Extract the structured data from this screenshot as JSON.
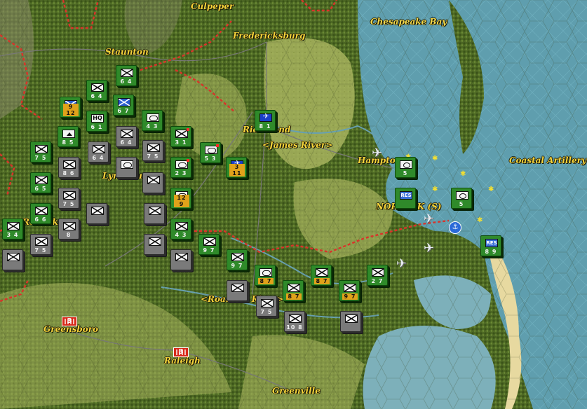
{
  "map": {
    "labels": {
      "culpeper": "Culpeper",
      "fredericksburg": "Fredericksburg",
      "chesapeake": "Chesapeake Bay",
      "staunton": "Staunton",
      "richmond": "Richmond",
      "james_river": "<James River>",
      "hampton": "Hampton",
      "coastal_artillery": "Coastal Artillery",
      "lynchburg": "Lynchburg",
      "norfolk": "NORFOLK (S)",
      "roanoke": "Roanoke",
      "roanoke_river": "<Roanoke River>",
      "greensboro": "Greensboro",
      "raleigh": "Raleigh",
      "greenville": "Greenville"
    },
    "city_markers": {
      "greensboro": "3",
      "raleigh": "3"
    },
    "colors": {
      "axis_unit": "#2f8a2a",
      "allied_unit": "#7a7a7a",
      "frontline": "#d8342a",
      "water": "#5a9aa8",
      "label": "#f6d43a"
    }
  },
  "units": {
    "u1": {
      "str": "6 4",
      "icon": "infantry-icon"
    },
    "u2": {
      "str": "6 4",
      "icon": "infantry-icon"
    },
    "u3": {
      "str": "9 12",
      "icon": "cavalry-icon"
    },
    "u4": {
      "str": "6 7",
      "icon": "cavalry-icon"
    },
    "u5": {
      "hq": "HQ",
      "str": "6 1",
      "icon": "hq-icon"
    },
    "u6": {
      "str": "8 5",
      "icon": "mountain-icon"
    },
    "u7": {
      "str": "4 3",
      "icon": "armor-icon"
    },
    "u8": {
      "str": "3 1",
      "icon": "infantry-icon"
    },
    "u9": {
      "str": "5 3",
      "icon": "armor-icon"
    },
    "u10": {
      "str": "2 3",
      "icon": "armor-icon"
    },
    "u11": {
      "str": "12 9",
      "icon": "armor-icon"
    },
    "u12": {
      "str": "4 3",
      "icon": "infantry-icon"
    },
    "u13": {
      "str": "8 1",
      "icon": "air-icon"
    },
    "u14": {
      "str": "3 11",
      "icon": "air-icon"
    },
    "u15": {
      "str": "7 5",
      "icon": "infantry-icon"
    },
    "u16": {
      "str": "6 5",
      "icon": "infantry-icon"
    },
    "u17": {
      "str": "9 7",
      "icon": "infantry-icon"
    },
    "u18": {
      "str": "8 7",
      "icon": "armor-icon"
    },
    "u19": {
      "str": "8 7",
      "icon": "infantry-icon"
    },
    "u20": {
      "str": "8 7",
      "icon": "infantry-icon"
    },
    "u21": {
      "str": "9 7",
      "icon": "infantry-icon"
    },
    "u22": {
      "str": "2 7",
      "icon": "infantry-icon"
    },
    "u23": {
      "str": "9 7",
      "icon": "infantry-icon"
    },
    "u24": {
      "str": "6 6",
      "icon": "infantry-icon"
    },
    "u25": {
      "str": "3 4",
      "icon": "infantry-icon"
    },
    "u26": {
      "str": "5",
      "icon": "coastal-icon"
    },
    "u27": {
      "res": "RES",
      "str": "",
      "icon": "reserve-icon"
    },
    "u28": {
      "str": "5",
      "icon": "coastal-icon"
    },
    "u29": {
      "res": "RES",
      "str": "8 9",
      "icon": "reserve-icon"
    },
    "g1": {
      "str": "6 4",
      "icon": "infantry-icon"
    },
    "g2": {
      "str": "6 4",
      "icon": "infantry-icon"
    },
    "g3": {
      "str": "7 5",
      "icon": "infantry-icon"
    },
    "g4": {
      "str": "8 6",
      "icon": "infantry-icon"
    },
    "g5": {
      "str": "7 5",
      "icon": "infantry-icon"
    },
    "g6": {
      "str": "8",
      "icon": "infantry-icon"
    },
    "g7": {
      "str": "",
      "icon": "armor-icon"
    },
    "g8": {
      "str": "",
      "icon": "infantry-icon"
    },
    "g9": {
      "str": "",
      "icon": "infantry-icon"
    },
    "g10": {
      "str": "",
      "icon": "infantry-icon"
    },
    "g11": {
      "str": "7 5",
      "icon": "infantry-icon"
    },
    "g12": {
      "str": "",
      "icon": "infantry-icon"
    },
    "g13": {
      "str": "",
      "icon": "infantry-icon"
    },
    "g14": {
      "str": "7 5",
      "icon": "infantry-icon"
    },
    "g15": {
      "str": "10 8",
      "icon": "infantry-icon"
    },
    "g16": {
      "str": "",
      "icon": "infantry-icon"
    },
    "g17": {
      "str": "",
      "icon": "infantry-icon"
    }
  }
}
